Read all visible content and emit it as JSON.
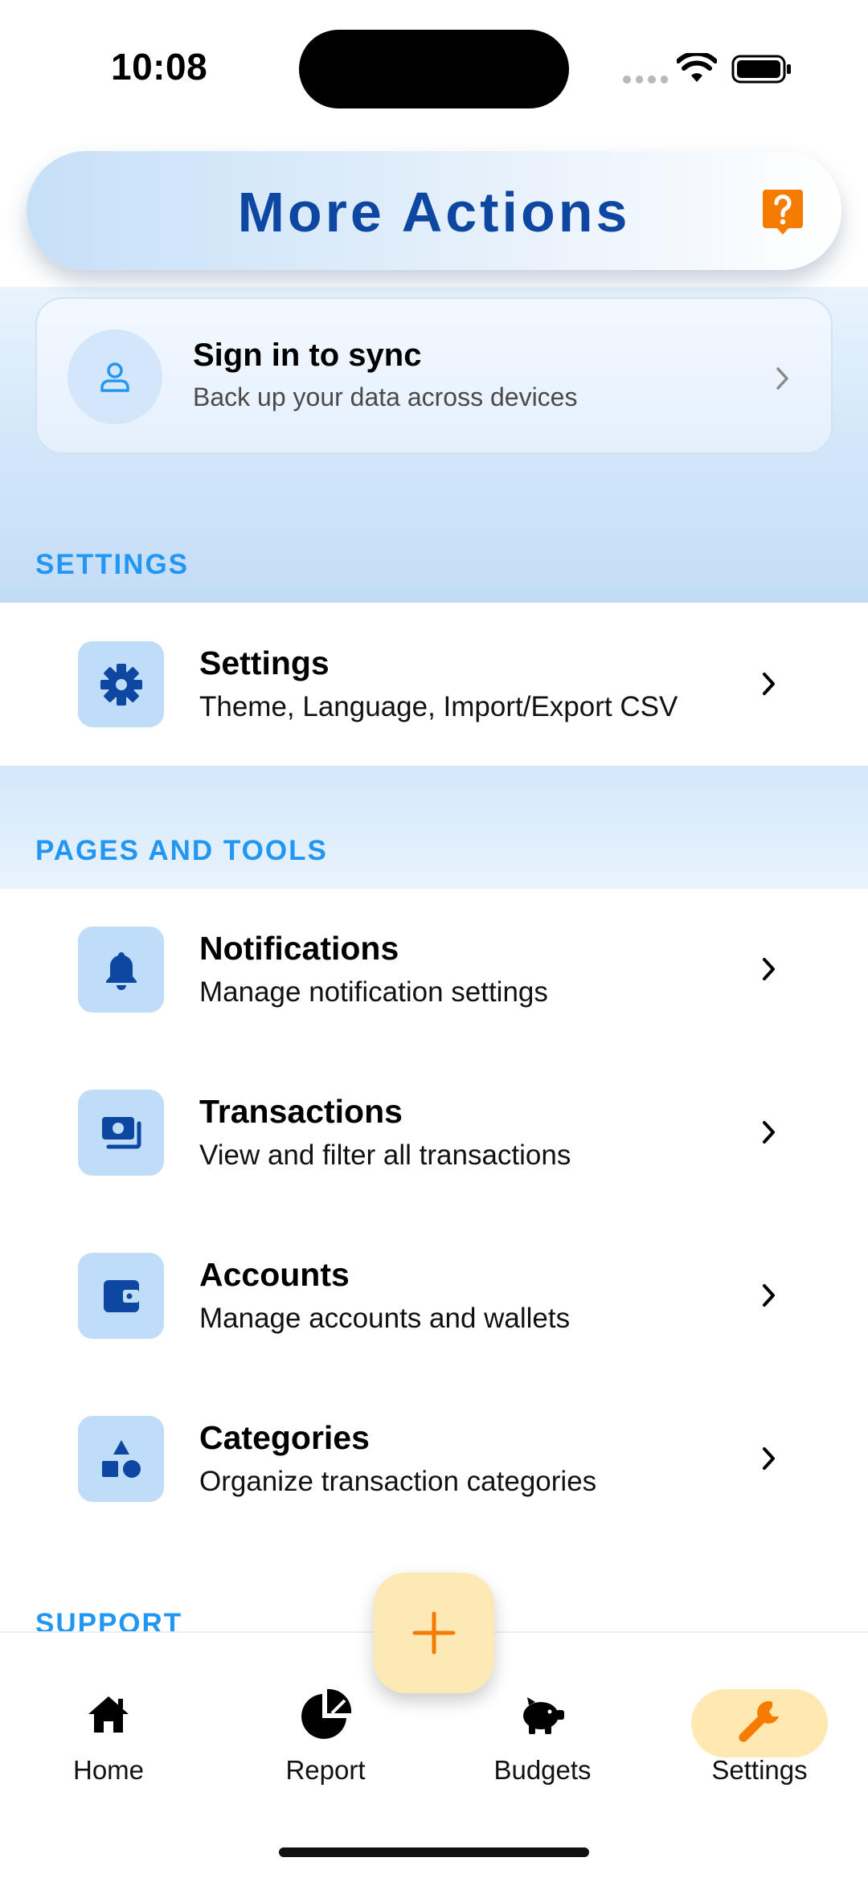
{
  "status_bar": {
    "time": "10:08"
  },
  "header": {
    "title": "More Actions"
  },
  "sign_in": {
    "title": "Sign in to sync",
    "subtitle": "Back up your data across devices"
  },
  "sections": {
    "settings": "SETTINGS",
    "pages_and_tools": "PAGES AND TOOLS",
    "support": "SUPPORT"
  },
  "settings_row": {
    "title": "Settings",
    "subtitle": "Theme, Language, Import/Export CSV",
    "icon": "gear-icon"
  },
  "tools": [
    {
      "title": "Notifications",
      "subtitle": "Manage notification settings",
      "icon": "bell-icon"
    },
    {
      "title": "Transactions",
      "subtitle": "View and filter all transactions",
      "icon": "money-icon"
    },
    {
      "title": "Accounts",
      "subtitle": "Manage accounts and wallets",
      "icon": "wallet-icon"
    },
    {
      "title": "Categories",
      "subtitle": "Organize transaction categories",
      "icon": "shapes-icon"
    }
  ],
  "bottom_nav": {
    "items": [
      {
        "label": "Home",
        "icon": "home-icon"
      },
      {
        "label": "Report",
        "icon": "pie-chart-icon"
      },
      {
        "label": "Budgets",
        "icon": "piggy-bank-icon"
      },
      {
        "label": "Settings",
        "icon": "wrench-icon",
        "active": true
      }
    ]
  },
  "colors": {
    "brand_blue": "#0d47a1",
    "section_blue": "#2196f3",
    "accent_orange": "#f57c00",
    "icon_tile": "#bfdcf9",
    "active_pill": "#ffe9b0"
  }
}
